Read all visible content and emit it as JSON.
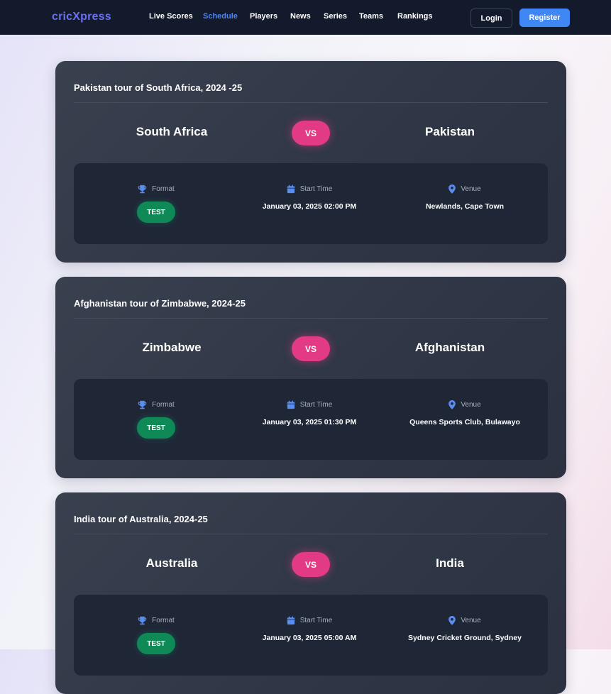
{
  "navbar": {
    "brand": "cricXpress",
    "links": [
      {
        "label": "Live Scores",
        "active": false
      },
      {
        "label": "Schedule",
        "active": true
      },
      {
        "label": "Players",
        "active": false
      },
      {
        "label": "News",
        "active": false
      },
      {
        "label": "Series",
        "active": false
      },
      {
        "label": "Teams",
        "active": false
      },
      {
        "label": "Rankings",
        "active": false
      }
    ],
    "login_label": "Login",
    "register_label": "Register"
  },
  "labels": {
    "vs": "VS",
    "format": "Format",
    "start_time": "Start Time",
    "venue": "Venue"
  },
  "icons": {
    "format": "trophy-icon",
    "start_time": "calendar-icon",
    "venue": "location-pin-icon"
  },
  "colors": {
    "accent_blue": "#3f87f5",
    "vs_pink": "#e23a85",
    "format_green": "#0f8a57",
    "card_bg": "#343b4a",
    "navbar_bg": "#131a2b"
  },
  "matches": [
    {
      "series": "Pakistan tour of South Africa, 2024 -25",
      "home_team": "South Africa",
      "away_team": "Pakistan",
      "format": "TEST",
      "start_time": "January 03, 2025 02:00 PM",
      "venue": "Newlands, Cape Town"
    },
    {
      "series": "Afghanistan tour of Zimbabwe, 2024-25",
      "home_team": "Zimbabwe",
      "away_team": "Afghanistan",
      "format": "TEST",
      "start_time": "January 03, 2025 01:30 PM",
      "venue": "Queens Sports Club, Bulawayo"
    },
    {
      "series": "India tour of Australia, 2024-25",
      "home_team": "Australia",
      "away_team": "India",
      "format": "TEST",
      "start_time": "January 03, 2025 05:00 AM",
      "venue": "Sydney Cricket Ground, Sydney"
    }
  ]
}
